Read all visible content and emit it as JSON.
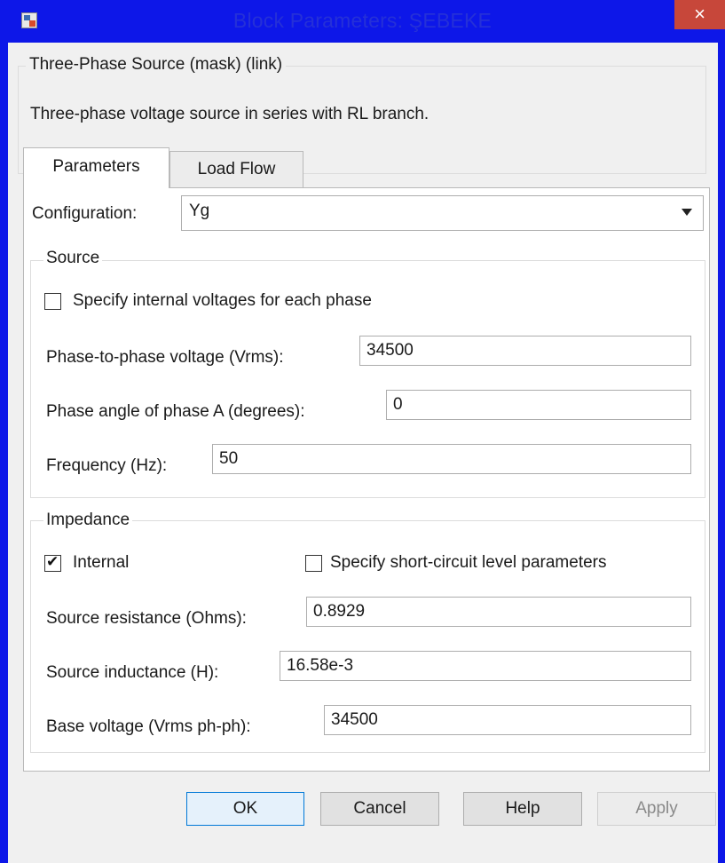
{
  "window": {
    "title": "Block Parameters: ŞEBEKE",
    "close_symbol": "×",
    "app_icon": "simulink-block-icon"
  },
  "mask": {
    "title": "Three-Phase Source (mask) (link)",
    "description": "Three-phase voltage source in series with RL branch."
  },
  "tabs": [
    {
      "label": "Parameters",
      "active": true
    },
    {
      "label": "Load Flow",
      "active": false
    }
  ],
  "configuration": {
    "label": "Configuration:",
    "value": "Yg"
  },
  "source": {
    "group_title": "Source",
    "specify_internal": {
      "label": "Specify internal voltages for each phase",
      "checked": false
    },
    "phase_voltage": {
      "label": "Phase-to-phase voltage (Vrms):",
      "value": "34500"
    },
    "phase_angle": {
      "label": "Phase angle of phase A (degrees):",
      "value": "0"
    },
    "frequency": {
      "label": "Frequency (Hz):",
      "value": "50"
    }
  },
  "impedance": {
    "group_title": "Impedance",
    "internal": {
      "label": "Internal",
      "checked": true
    },
    "short_circuit": {
      "label": "Specify short-circuit level parameters",
      "checked": false
    },
    "resistance": {
      "label": "Source resistance (Ohms):",
      "value": "0.8929"
    },
    "inductance": {
      "label": "Source inductance (H):",
      "value": "16.58e-3"
    },
    "base_voltage": {
      "label": "Base voltage (Vrms ph-ph):",
      "value": "34500"
    }
  },
  "buttons": {
    "ok": "OK",
    "cancel": "Cancel",
    "help": "Help",
    "apply": "Apply"
  },
  "checkmark_symbol": "✔"
}
